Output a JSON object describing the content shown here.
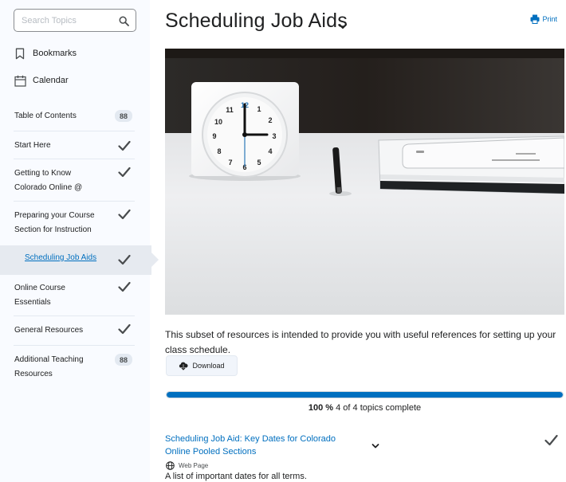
{
  "search": {
    "placeholder": "Search Topics",
    "icon": "search-icon"
  },
  "nav_links": [
    {
      "label": "Bookmarks",
      "icon": "bookmark-icon"
    },
    {
      "label": "Calendar",
      "icon": "calendar-icon"
    }
  ],
  "toc": {
    "header": {
      "label": "Table of Contents",
      "badge": "88"
    },
    "items": [
      {
        "label": "Start Here",
        "completed": true
      },
      {
        "label": "Getting to Know Colorado Online @",
        "completed": true
      },
      {
        "label": "Preparing your Course Section for Instruction",
        "completed": true
      },
      {
        "label": "Scheduling Job Aids",
        "completed": true,
        "active": true
      },
      {
        "label": "Online Course Essentials",
        "completed": true
      },
      {
        "label": "General Resources",
        "completed": true
      },
      {
        "label": "Additional Teaching Resources",
        "badge": "88"
      }
    ]
  },
  "main": {
    "title": "Scheduling Job Aids",
    "print_label": "Print",
    "description": "This subset of resources is intended to provide you with useful references for setting up your class schedule.",
    "download_label": "Download",
    "progress": {
      "percent": 100,
      "percent_label": "100 %",
      "summary": "4 of 4 topics complete"
    },
    "topic": {
      "title": "Scheduling Job Aid: Key Dates for Colorado Online Pooled Sections",
      "type": "Web Page",
      "description": "A list of important dates for all terms.",
      "completed": true
    }
  },
  "colors": {
    "accent": "#006fbf",
    "sidebar_bg": "#f9fbff",
    "active_bg": "#e6eaf0",
    "badge_bg": "#e3e9f1"
  }
}
